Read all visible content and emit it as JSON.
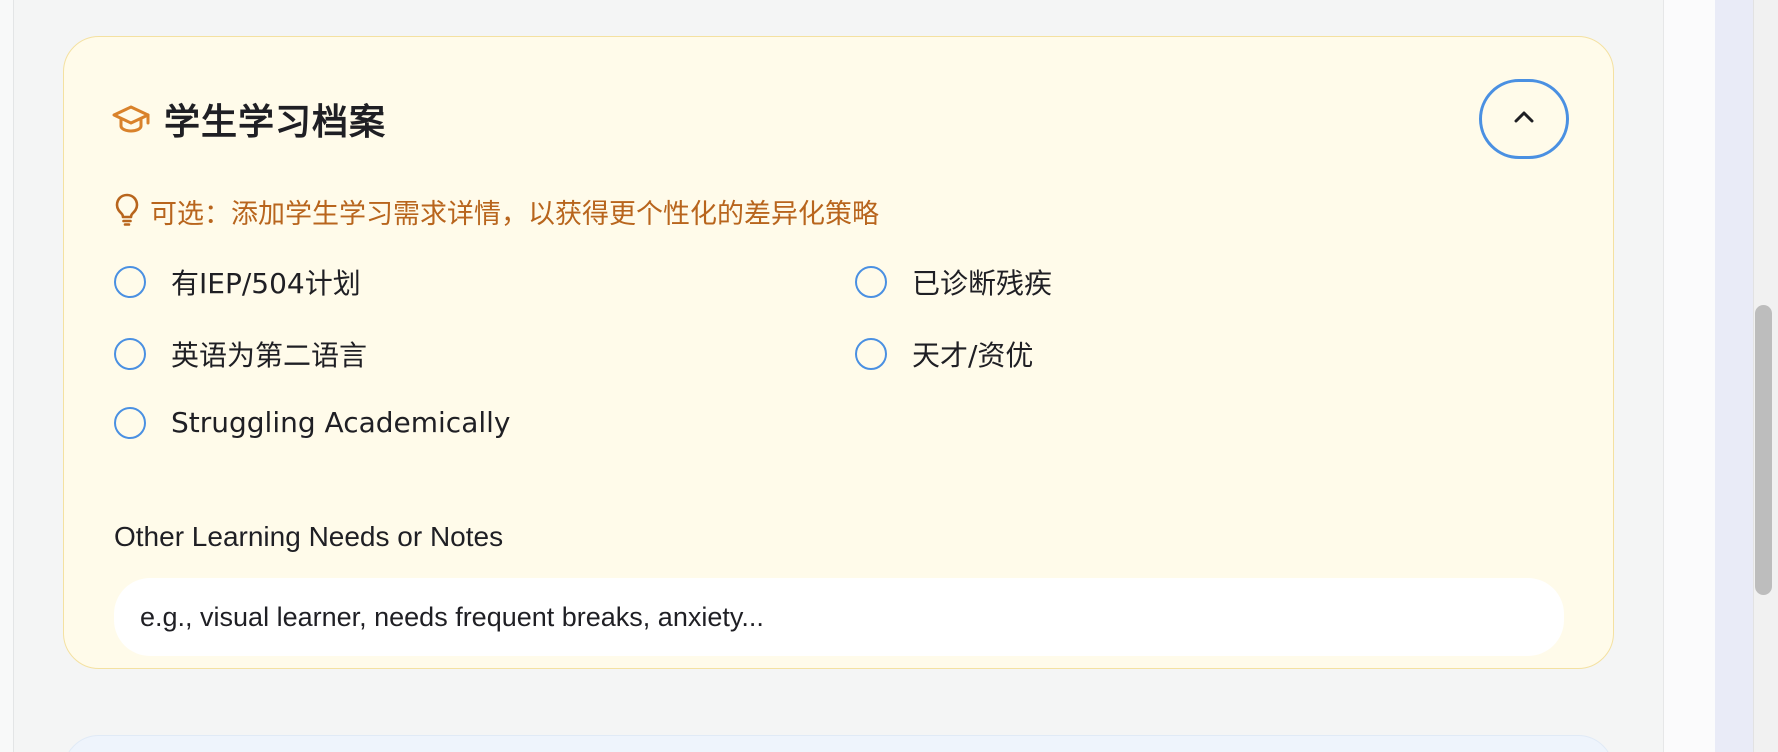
{
  "card": {
    "icon": "graduation-cap-icon",
    "title": "学生学习档案",
    "collapse_icon": "chevron-up-icon",
    "hint": {
      "icon": "lightbulb-icon",
      "text": "可选：添加学生学习需求详情，以获得更个性化的差异化策略"
    },
    "options": [
      {
        "label": "有IEP/504计划"
      },
      {
        "label": "已诊断残疾"
      },
      {
        "label": "英语为第二语言"
      },
      {
        "label": "天才/资优"
      },
      {
        "label": "Struggling Academically"
      }
    ],
    "notes": {
      "label": "Other Learning Needs or Notes",
      "placeholder": "e.g., visual learner, needs frequent breaks, anxiety..."
    }
  },
  "colors": {
    "accent": "#4a90e2",
    "hint": "#b8651d",
    "card_background": "#fffbea",
    "card_border": "#f4e1a1",
    "icon": "#d9822b"
  }
}
